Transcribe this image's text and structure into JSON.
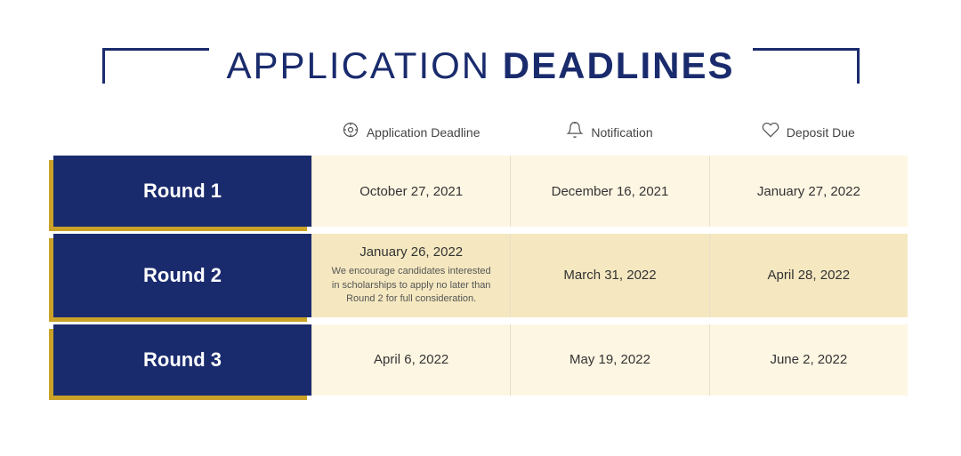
{
  "title": {
    "part1": "APPLICATION ",
    "part2": "DEADLINES"
  },
  "header": {
    "col1_label": "",
    "col2_label": "Application Deadline",
    "col3_label": "Notification",
    "col4_label": "Deposit Due",
    "col2_icon": "⏱",
    "col3_icon": "🔔",
    "col4_icon": "🤝"
  },
  "rounds": [
    {
      "label": "Round 1",
      "deadline": "October 27, 2021",
      "notification": "December 16, 2021",
      "deposit": "January 27, 2022",
      "note": "",
      "highlighted": false
    },
    {
      "label": "Round 2",
      "deadline": "January 26, 2022",
      "notification": "March 31, 2022",
      "deposit": "April 28, 2022",
      "note": "We encourage candidates interested in scholarships to apply no later than Round 2 for full consideration.",
      "highlighted": true
    },
    {
      "label": "Round 3",
      "deadline": "April 6, 2022",
      "notification": "May 19, 2022",
      "deposit": "June 2, 2022",
      "note": "",
      "highlighted": false
    }
  ]
}
